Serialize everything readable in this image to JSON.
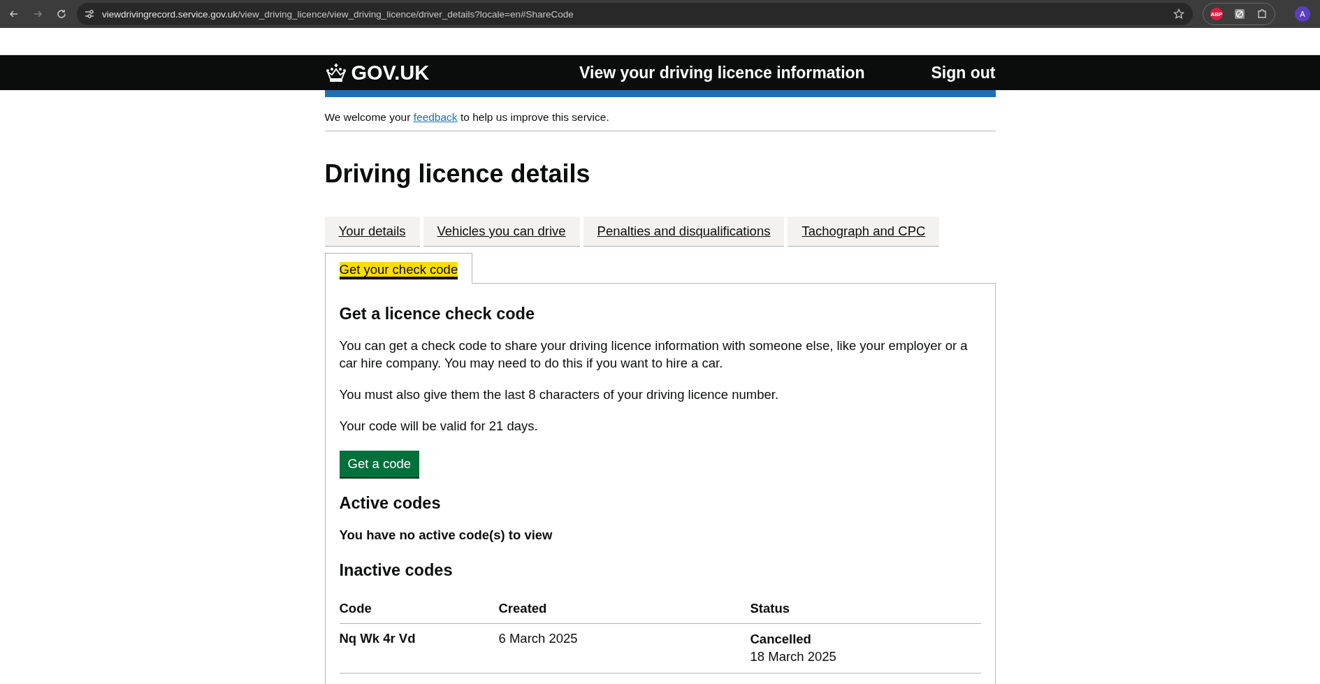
{
  "browser": {
    "url_host": "viewdrivingrecord.service.gov.uk",
    "url_path": "/view_driving_licence/view_driving_licence/driver_details?locale=en#ShareCode",
    "extension_label": "ABP",
    "profile_initial": "A"
  },
  "header": {
    "logo": "GOV.UK",
    "service_name": "View your driving licence information",
    "sign_out": "Sign out"
  },
  "feedback": {
    "before": "We welcome your",
    "link": "feedback",
    "after": "to help us improve this service."
  },
  "title": "Driving licence details",
  "tabs": [
    {
      "label": "Your details",
      "selected": false
    },
    {
      "label": "Vehicles you can drive",
      "selected": false
    },
    {
      "label": "Penalties and disqualifications",
      "selected": false
    },
    {
      "label": "Tachograph and CPC",
      "selected": false
    },
    {
      "label": "Get your check code",
      "selected": true
    }
  ],
  "panel": {
    "heading": "Get a licence check code",
    "paragraphs": [
      "You can get a check code to share your driving licence information with someone else, like your employer or a car hire company. You may need to do this if you want to hire a car.",
      "You must also give them the last 8 characters of your driving licence number.",
      "Your code will be valid for 21 days."
    ],
    "button": "Get a code",
    "active_heading": "Active codes",
    "active_empty": "You have no active code(s) to view",
    "inactive_heading": "Inactive codes",
    "table": {
      "columns": [
        "Code",
        "Created",
        "Status"
      ],
      "rows": [
        {
          "code": "Nq Wk 4r Vd",
          "created": "6 March 2025",
          "status": "Cancelled",
          "status_date": "18 March 2025"
        }
      ]
    }
  }
}
